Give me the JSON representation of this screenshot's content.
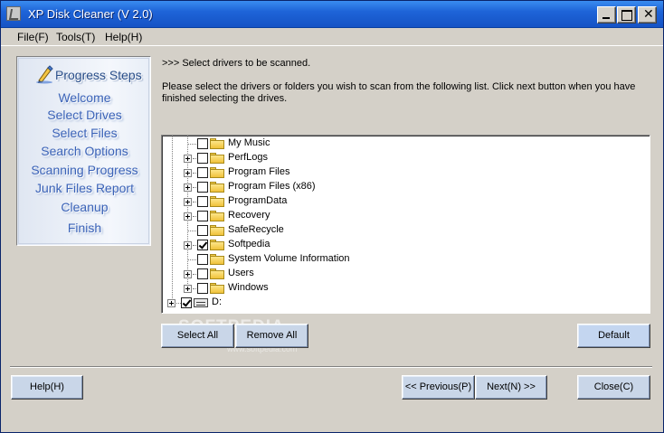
{
  "window": {
    "title": "XP Disk Cleaner (V 2.0)"
  },
  "menubar": {
    "file": "File(F)",
    "tools": "Tools(T)",
    "help": "Help(H)"
  },
  "steps": {
    "title": "Progress Steps",
    "items": [
      "Welcome",
      "Select Drives",
      "Select Files",
      "Search Options",
      "Scanning Progress",
      "Junk Files Report",
      "Cleanup",
      "Finish"
    ]
  },
  "instructions": {
    "heading": ">>> Select drivers to be scanned.",
    "body": "Please select the drivers or folders you wish to scan from the following list. Click next button when you have finished selecting the drives."
  },
  "tree": {
    "items": [
      {
        "label": "My Music",
        "checked": false,
        "expandable": false
      },
      {
        "label": "PerfLogs",
        "checked": false,
        "expandable": true
      },
      {
        "label": "Program Files",
        "checked": false,
        "expandable": true
      },
      {
        "label": "Program Files (x86)",
        "checked": false,
        "expandable": true
      },
      {
        "label": "ProgramData",
        "checked": false,
        "expandable": true
      },
      {
        "label": "Recovery",
        "checked": false,
        "expandable": true
      },
      {
        "label": "SafeRecycle",
        "checked": false,
        "expandable": false
      },
      {
        "label": "Softpedia",
        "checked": true,
        "expandable": true
      },
      {
        "label": "System Volume Information",
        "checked": false,
        "expandable": false
      },
      {
        "label": "Users",
        "checked": false,
        "expandable": true
      },
      {
        "label": "Windows",
        "checked": false,
        "expandable": true
      }
    ],
    "drive": {
      "label": "D:",
      "checked": true
    }
  },
  "buttons": {
    "select_all": "Select All",
    "remove_all": "Remove All",
    "default": "Default",
    "help": "Help(H)",
    "previous": "<< Previous(P)",
    "next": "Next(N) >>",
    "close": "Close(C)"
  },
  "watermark": {
    "text": "SOFTPEDIA",
    "sub": "www.softpedia.com"
  }
}
